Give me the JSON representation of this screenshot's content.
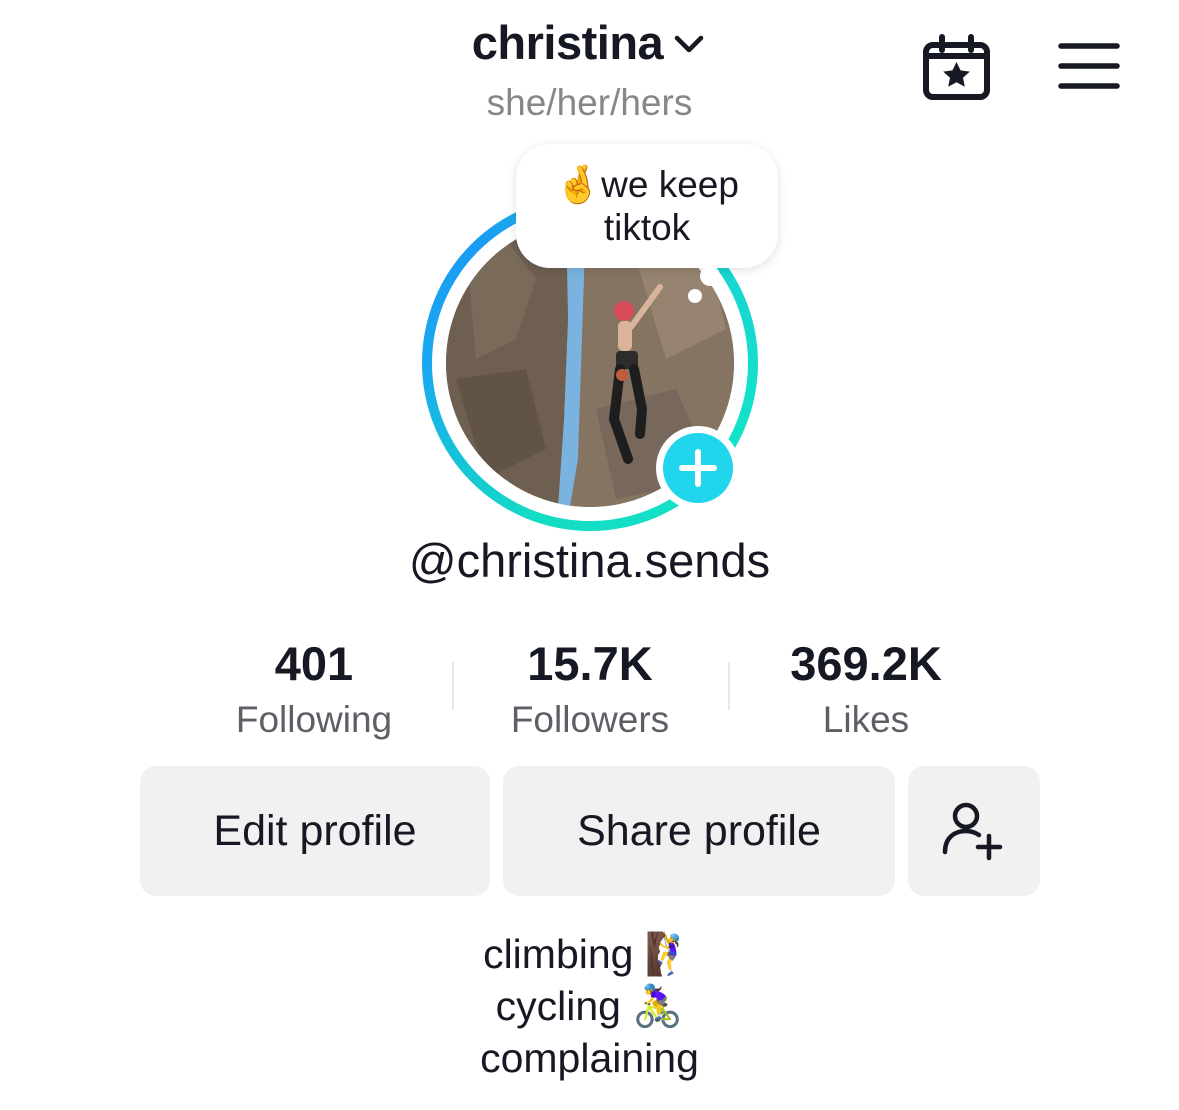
{
  "header": {
    "username": "christina",
    "pronouns": "she/her/hers",
    "icons": {
      "dropdown": "chevron-down-icon",
      "calendar": "calendar-star-icon",
      "menu": "hamburger-menu-icon"
    }
  },
  "avatar": {
    "note": {
      "emoji": "🤞",
      "line1": "we keep",
      "line2": "tiktok"
    },
    "add_icon": "plus-icon",
    "ring_colors": [
      "#1a9bf2",
      "#12e3c8"
    ]
  },
  "handle": "@christina.sends",
  "stats": [
    {
      "value": "401",
      "label": "Following"
    },
    {
      "value": "15.7K",
      "label": "Followers"
    },
    {
      "value": "369.2K",
      "label": "Likes"
    }
  ],
  "buttons": {
    "edit": "Edit profile",
    "share": "Share profile",
    "add_friends_icon": "add-friend-icon"
  },
  "bio": {
    "line1": "climbing 🧗‍♀️",
    "line2": "cycling 🚴‍♀️",
    "line3": "complaining"
  },
  "colors": {
    "accent": "#20d5ec",
    "button_bg": "#f1f1f2",
    "text": "#161823",
    "muted": "#86878b"
  }
}
